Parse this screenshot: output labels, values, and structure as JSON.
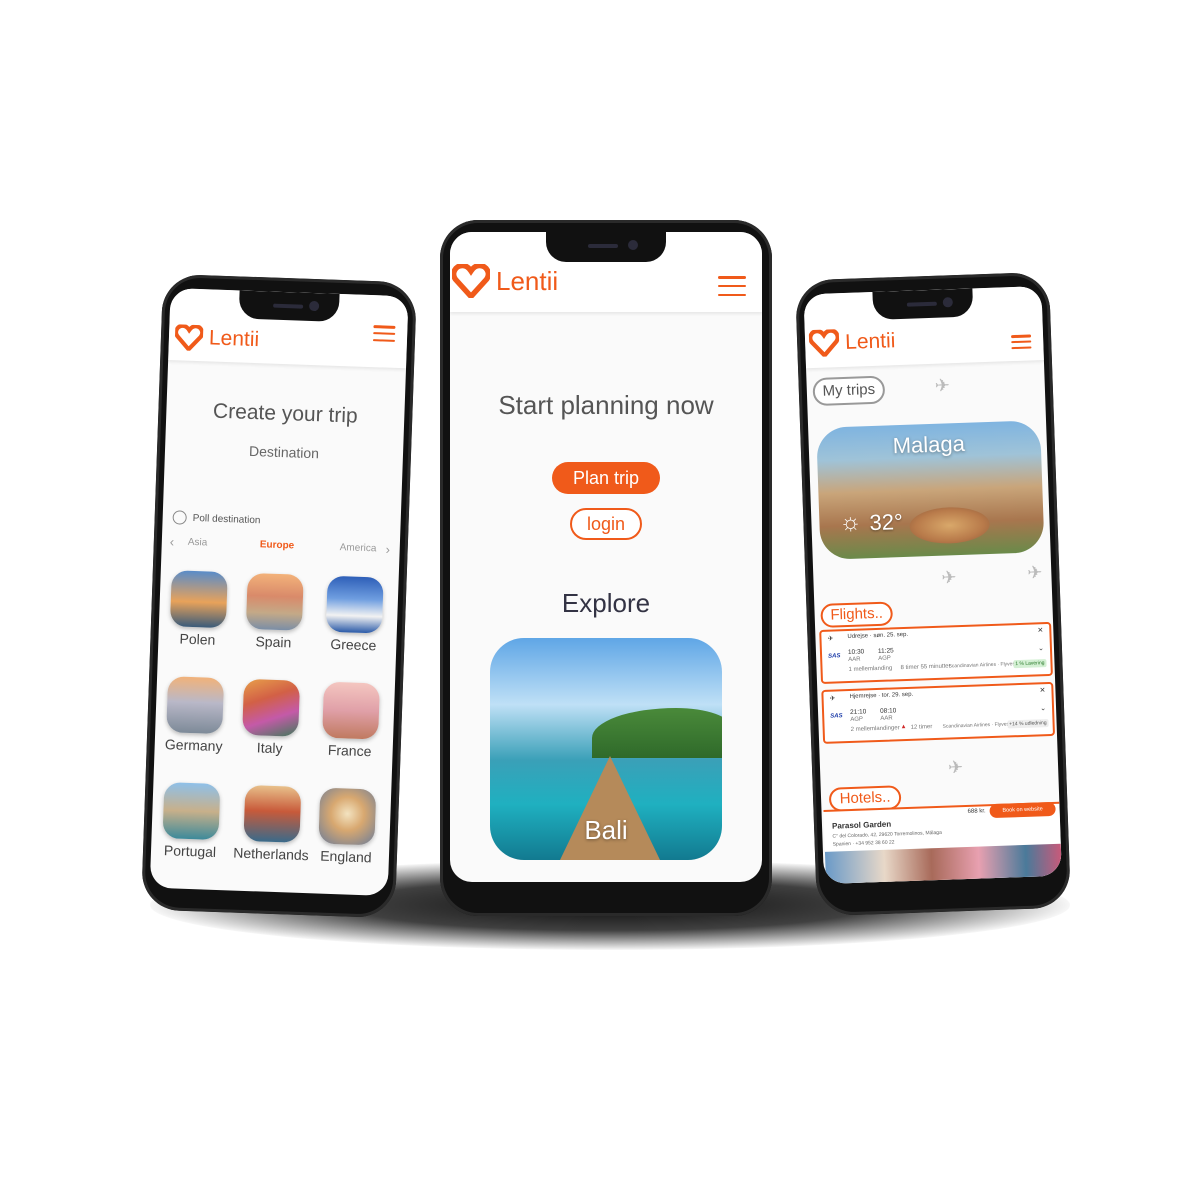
{
  "brand": {
    "name": "Lentii",
    "accent": "#f05a1a"
  },
  "left": {
    "title": "Create your trip",
    "subtitle": "Destination",
    "poll_label": "Poll destination",
    "regions": {
      "prev": "Asia",
      "current": "Europe",
      "next": "America"
    },
    "countries": [
      {
        "label": "Polen"
      },
      {
        "label": "Spain"
      },
      {
        "label": "Greece"
      },
      {
        "label": "Germany"
      },
      {
        "label": "Italy"
      },
      {
        "label": "France"
      },
      {
        "label": "Portugal"
      },
      {
        "label": "Netherlands"
      },
      {
        "label": "England"
      }
    ]
  },
  "center": {
    "headline": "Start planning now",
    "plan_button": "Plan trip",
    "login_button": "login",
    "explore_title": "Explore",
    "featured": "Bali"
  },
  "right": {
    "my_trips": "My trips",
    "destination": "Malaga",
    "temperature": "32°",
    "flights_label": "Flights..",
    "flights": [
      {
        "header": "Udrejse · søn. 25. sep.",
        "airline_code": "SAS",
        "dep_time": "10:30",
        "arr_time": "11:25",
        "from": "AAR",
        "to": "AGP",
        "stops": "1 mellemlanding",
        "duration": "8 timer 55 minutter",
        "carrier": "Scandinavian Airlines · Flyves af Kfly",
        "badge": "1 % Lavering"
      },
      {
        "header": "Hjemrejse · tor. 29. sep.",
        "airline_code": "SAS",
        "dep_time": "21:10",
        "arr_time": "08:10",
        "from": "AGP",
        "to": "AAR",
        "stops": "2 mellemlandinger",
        "duration": "12 timer",
        "carrier": "Scandinavian Airlines · Flyves af Kfly",
        "badge": "+14 % udledning"
      }
    ],
    "hotels_label": "Hotels..",
    "hotel": {
      "name": "Parasol Garden",
      "address": "C° del Colorado, 42, 29620 Torremolinos, Málaga",
      "phone": "Spanien · +34 952 38 60 22",
      "price": "688 kr.",
      "book_label": "Book on website"
    }
  }
}
